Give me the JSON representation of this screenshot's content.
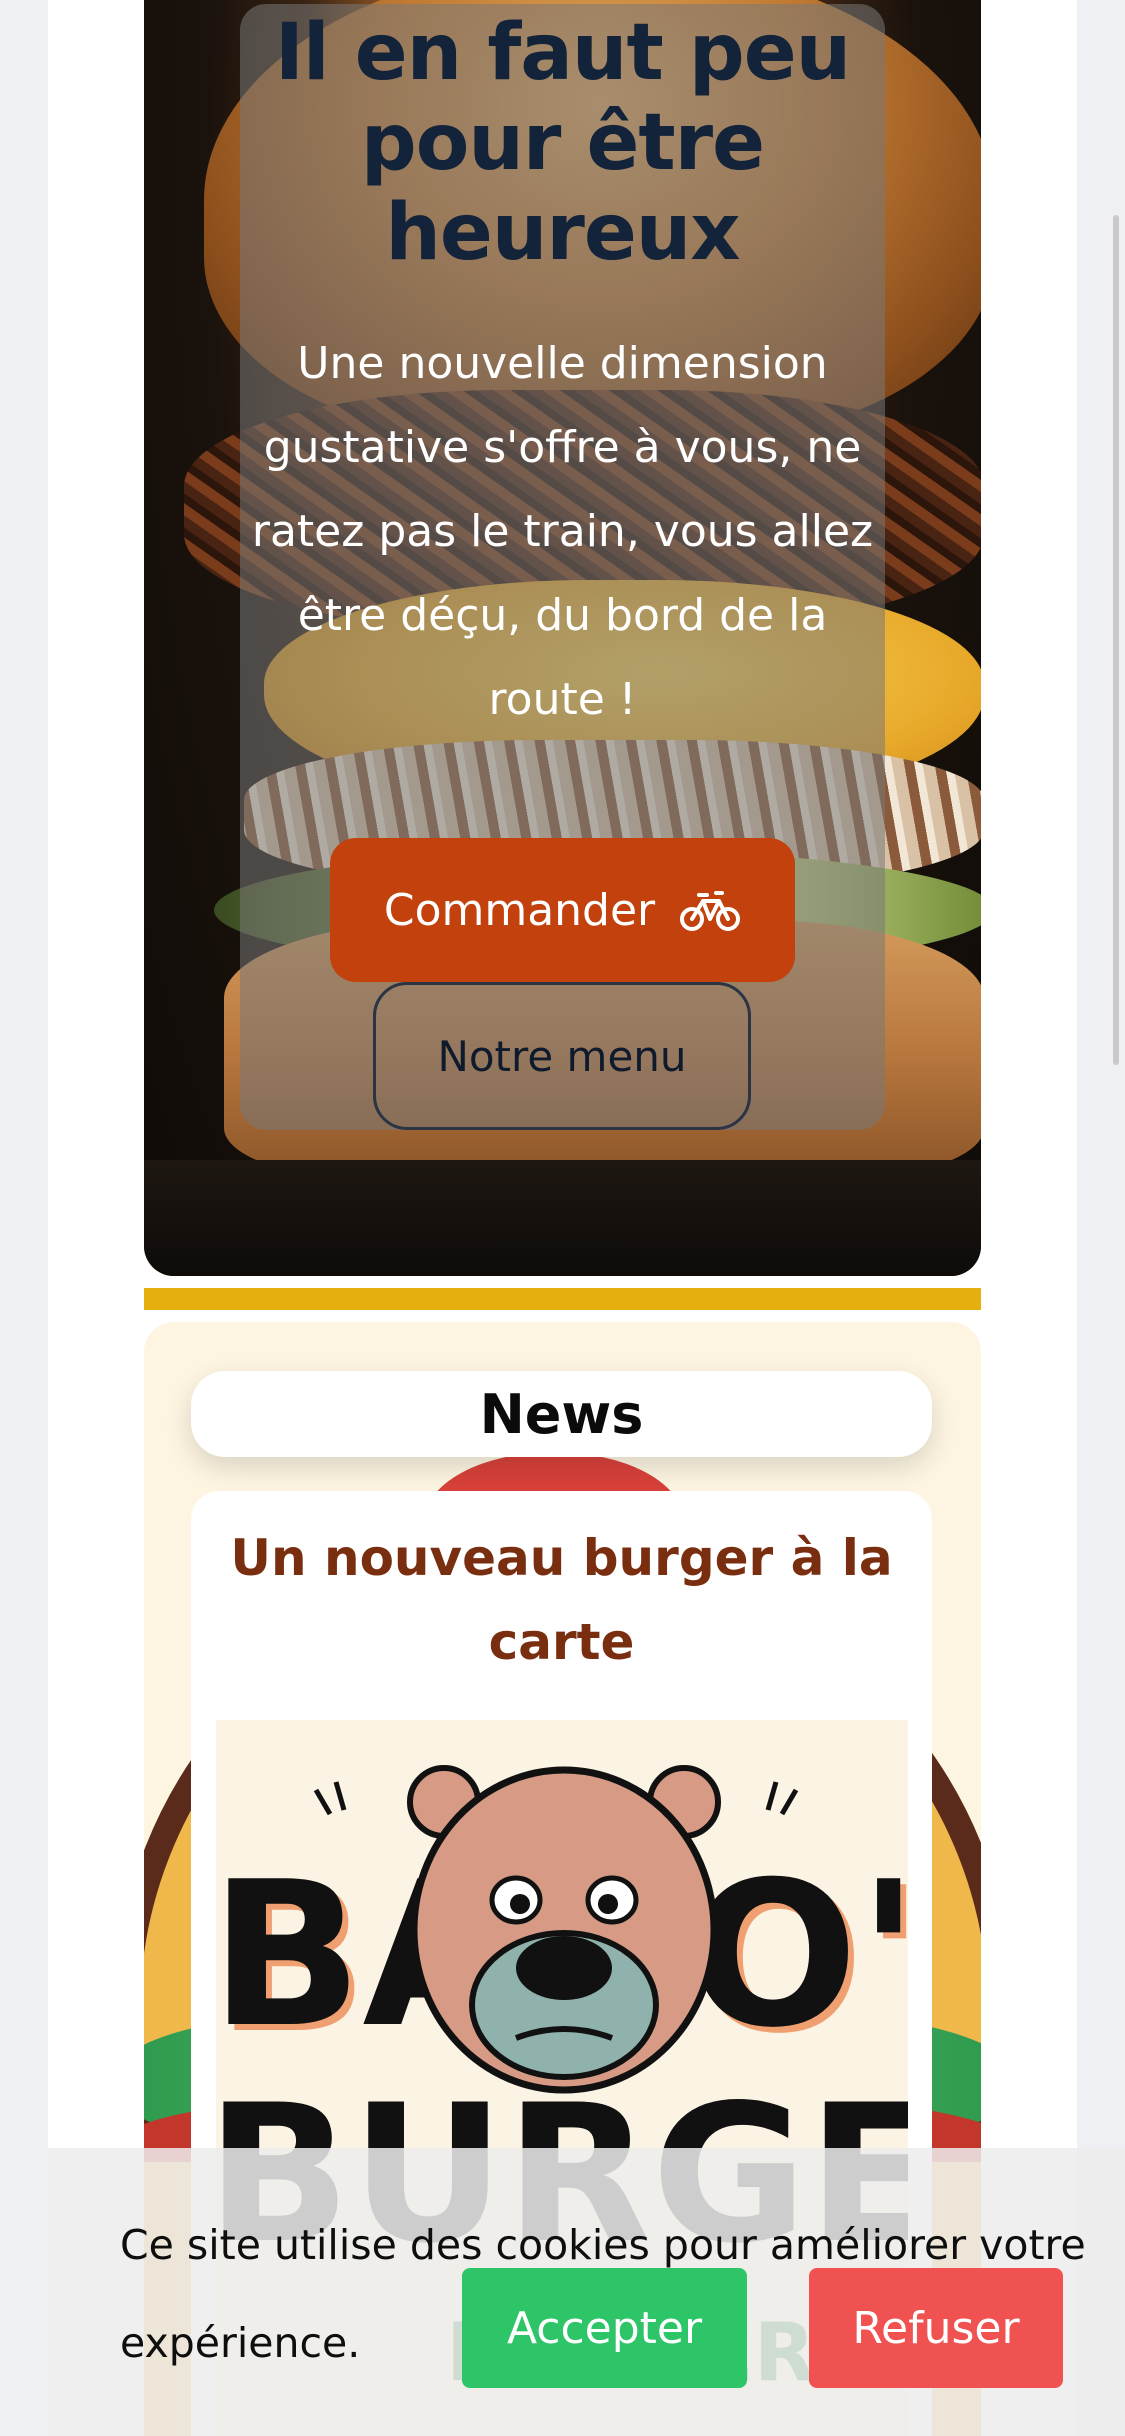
{
  "hero": {
    "title": "Il en faut peu pour être heureux",
    "description": "Une nouvelle dimension gustative s'offre à vous, ne ratez pas le train, vous allez être déçu, du bord de la route !",
    "order_button": "Commander",
    "order_icon": "bicycle-icon",
    "menu_button": "Notre menu"
  },
  "news": {
    "heading": "News",
    "article_title": "Un nouveau burger à la carte",
    "logo_text_line1": "BALOO'S",
    "logo_text_line2": "BURGERS",
    "logo_text_line3": "BURGER'S"
  },
  "cookie_banner": {
    "message": "Ce site utilise des cookies pour améliorer votre expérience.",
    "accept": "Accepter",
    "refuse": "Refuser"
  },
  "colors": {
    "accent_orange": "#c2410c",
    "divider_yellow": "#e5b00e",
    "accept_green": "#2ec468",
    "refuse_red": "#f05252",
    "title_navy": "#13233a",
    "article_title_brown": "#7a2e10"
  }
}
